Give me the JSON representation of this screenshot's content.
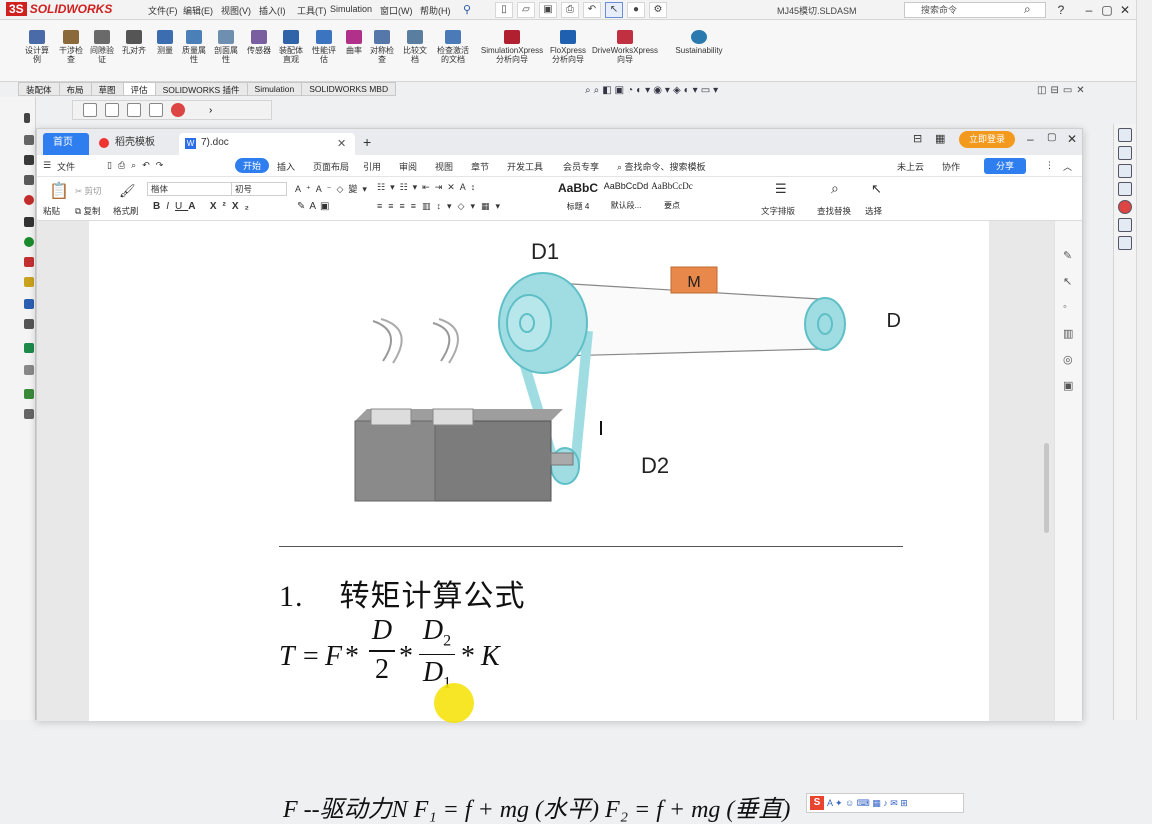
{
  "solidworks": {
    "logo": "SOLIDWORKS",
    "logo_prefix": "3S",
    "menu": [
      "文件(F)",
      "编辑(E)",
      "视图(V)",
      "插入(I)",
      "工具(T)",
      "Simulation",
      "窗口(W)",
      "帮助(H)"
    ],
    "filename": "MJ45模切.SLDASM",
    "search_placeholder": "搜索命令",
    "ribbon_tools": [
      {
        "label": "设计算例",
        "color": "#4a6aa8"
      },
      {
        "label": "干涉检查",
        "color": "#8a6a3a"
      },
      {
        "label": "间隙验证",
        "color": "#6a6a6a"
      },
      {
        "label": "孔对齐",
        "color": "#555555"
      },
      {
        "label": "测量",
        "color": "#3c6db0"
      },
      {
        "label": "质量属性",
        "color": "#4a7fb8"
      },
      {
        "label": "剖面属性",
        "color": "#6f8fb0"
      },
      {
        "label": "传感器",
        "color": "#7a5fa0"
      },
      {
        "label": "装配体直观",
        "color": "#2f65a8"
      },
      {
        "label": "性能评估",
        "color": "#3b75c0"
      },
      {
        "label": "曲率",
        "color": "#b0308a"
      },
      {
        "label": "对称检查",
        "color": "#5577aa"
      },
      {
        "label": "比较文档",
        "color": "#5a7ea0"
      },
      {
        "label": "检查激活的文档",
        "color": "#4a7ab8"
      },
      {
        "label": "SimulationXpress 分析向导",
        "color": "#b02030"
      },
      {
        "label": "FloXpress 分析向导",
        "color": "#2060b0"
      },
      {
        "label": "DriveWorksXpress 向导",
        "color": "#c03040"
      },
      {
        "label": "Sustainability",
        "color": "#2a7ab0"
      }
    ],
    "tabs": [
      "装配体",
      "布局",
      "草图",
      "评估",
      "SOLIDWORKS 插件",
      "Simulation",
      "SOLIDWORKS MBD"
    ],
    "active_tab_index": 3
  },
  "wps": {
    "tabs": {
      "home": "首页",
      "template": "稻壳模板",
      "doc": "7).doc"
    },
    "login_button": "立即登录",
    "menubar": {
      "file": "文件",
      "items": [
        "开始",
        "插入",
        "页面布局",
        "引用",
        "审阅",
        "视图",
        "章节",
        "开发工具",
        "会员专享"
      ],
      "search": "查找命令、搜索模板",
      "right_items": [
        "未上云",
        "协作"
      ],
      "share": "分享"
    },
    "toolbar": {
      "paste": "粘贴",
      "cut": "剪切",
      "copy": "复制",
      "format_painter": "格式刷",
      "font": "楷体",
      "font_size": "初号",
      "styles": [
        {
          "preview": "AaBbC",
          "name": "标题 4"
        },
        {
          "preview": "AaBbCcDd",
          "name": "默认段..."
        },
        {
          "preview": "AaBbCcDc",
          "name": "要点"
        }
      ],
      "text_layout": "文字排版",
      "find_replace": "查找替换",
      "select": "选择"
    },
    "document": {
      "figure": {
        "label_d1": "D1",
        "label_d2": "D2",
        "label_m": "M",
        "label_d": "D"
      },
      "heading_number": "1.",
      "heading_text": "转矩计算公式",
      "formula": {
        "lhs": "T =",
        "var_f": "F",
        "op": "*",
        "num1": "D",
        "den1": "2",
        "num2": "D",
        "num2_sub": "2",
        "den2": "D",
        "den2_sub": "1",
        "k": "K"
      },
      "line2": "F --驱动力N  F₁ = f + mg (水平)  F₂ = f + mg (垂直)"
    }
  },
  "colors": {
    "pulley": "#9fdde3",
    "pulley_stroke": "#5fbfc6",
    "mass_block": "#e8884a",
    "wps_accent": "#2f7ef0",
    "login_orange": "#f39a1e"
  }
}
